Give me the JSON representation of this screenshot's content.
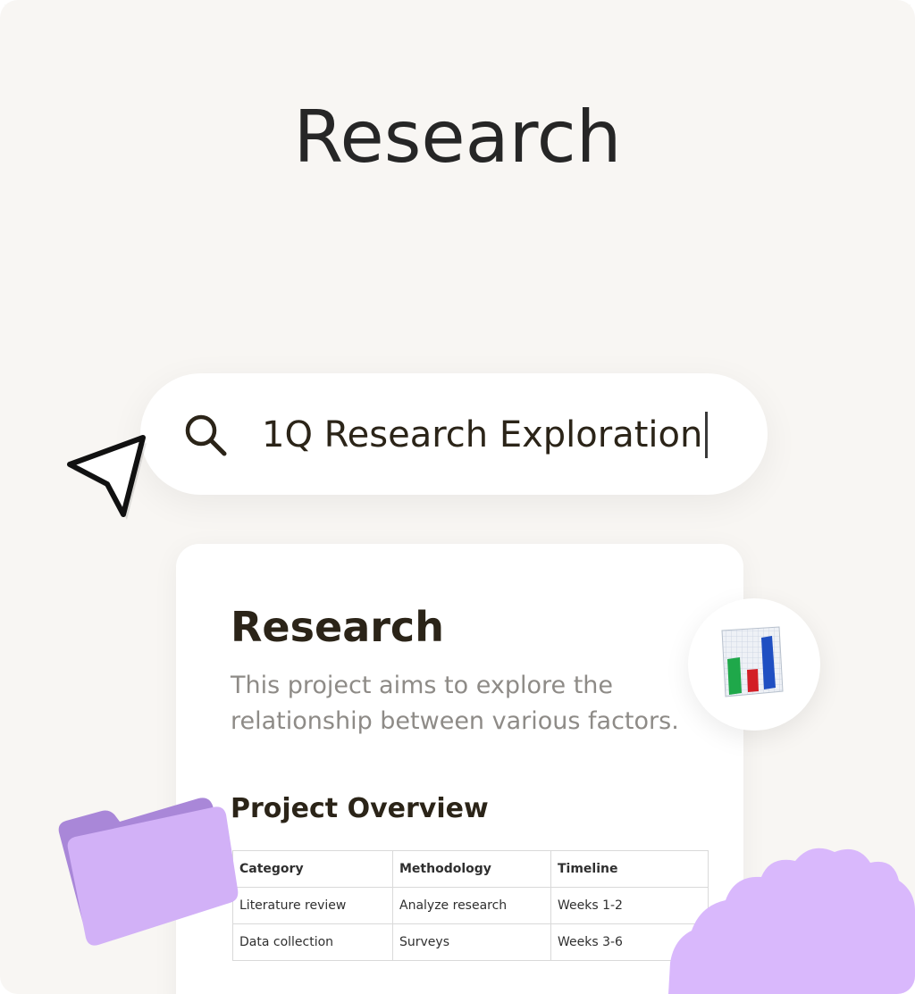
{
  "page": {
    "heading": "Research"
  },
  "search": {
    "query": "1Q Research Exploration",
    "icon": "search-icon"
  },
  "cursor": {
    "icon": "pointer-arrow-icon"
  },
  "document_card": {
    "title": "Research",
    "description": "This project aims to explore the relationship between various factors.",
    "section_title": "Project Overview",
    "table": {
      "headers": [
        "Category",
        "Methodology",
        "Timeline"
      ],
      "rows": [
        [
          "Literature review",
          "Analyze research",
          "Weeks 1-2"
        ],
        [
          "Data collection",
          "Surveys",
          "Weeks 3-6"
        ]
      ]
    }
  },
  "decorations": {
    "chart_badge_icon": "bar-chart-icon",
    "folder_icon": "folder-icon",
    "blob_shape": "purple-wavy-blob",
    "accent_purple": "#d7b6fb",
    "folder_purple": "#b189dc"
  },
  "colors": {
    "background": "#f8f6f3",
    "card": "#ffffff",
    "text_dark": "#2b2418",
    "text_muted": "#8e8b87"
  }
}
